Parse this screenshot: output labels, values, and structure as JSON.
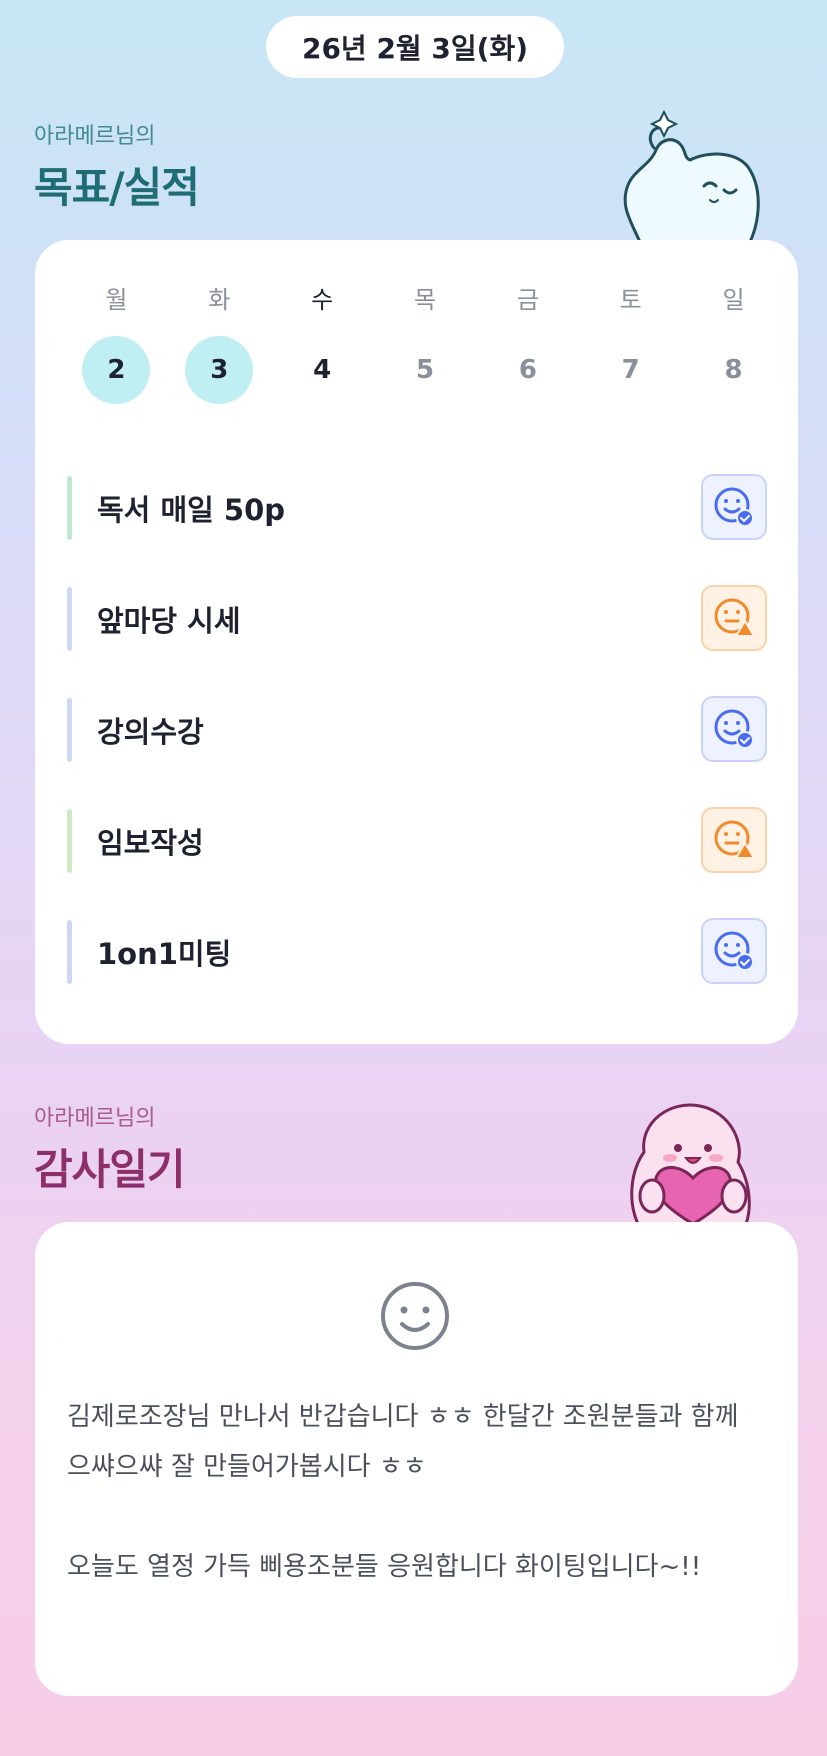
{
  "header": {
    "date": "26년 2월 3일(화)"
  },
  "goals_section": {
    "owner": "아라메르님의",
    "title": "목표/실적"
  },
  "week": {
    "day_names": [
      "월",
      "화",
      "수",
      "목",
      "금",
      "토",
      "일"
    ],
    "dates": [
      "2",
      "3",
      "4",
      "5",
      "6",
      "7",
      "8"
    ],
    "completed_days": [
      "2",
      "3"
    ],
    "current_day": "4"
  },
  "goals": [
    {
      "label": "독서 매일 50p",
      "bar_color": "#bfe8d0",
      "status": "good",
      "status_icon": "smile-check-icon"
    },
    {
      "label": "앞마당 시세",
      "bar_color": "#cfd8f3",
      "status": "warn",
      "status_icon": "neutral-warning-icon"
    },
    {
      "label": "강의수강",
      "bar_color": "#cfd8f3",
      "status": "good",
      "status_icon": "smile-check-icon"
    },
    {
      "label": "임보작성",
      "bar_color": "#cfeac2",
      "status": "warn",
      "status_icon": "neutral-warning-icon"
    },
    {
      "label": "1on1미팅",
      "bar_color": "#cfd8f3",
      "status": "good",
      "status_icon": "smile-check-icon"
    }
  ],
  "thanks_section": {
    "owner": "아라메르님의",
    "title": "감사일기"
  },
  "diary": {
    "mood_icon": "smile-face-icon",
    "paragraphs": [
      "김제로조장님 만나서 반갑습니다 ㅎㅎ 한달간 조원분들과 함께 으쌰으쌰 잘 만들어가봅시다 ㅎㅎ",
      "오늘도 열정 가득 삐용조분들 응원합니다 화이팅입니다~!!"
    ]
  },
  "colors": {
    "good_icon": "#4a6cf0",
    "warn_icon": "#f08a2a",
    "done_day_bg": "#bfeef3",
    "goals_title": "#1f6d74",
    "thanks_title": "#8d2f6a"
  }
}
